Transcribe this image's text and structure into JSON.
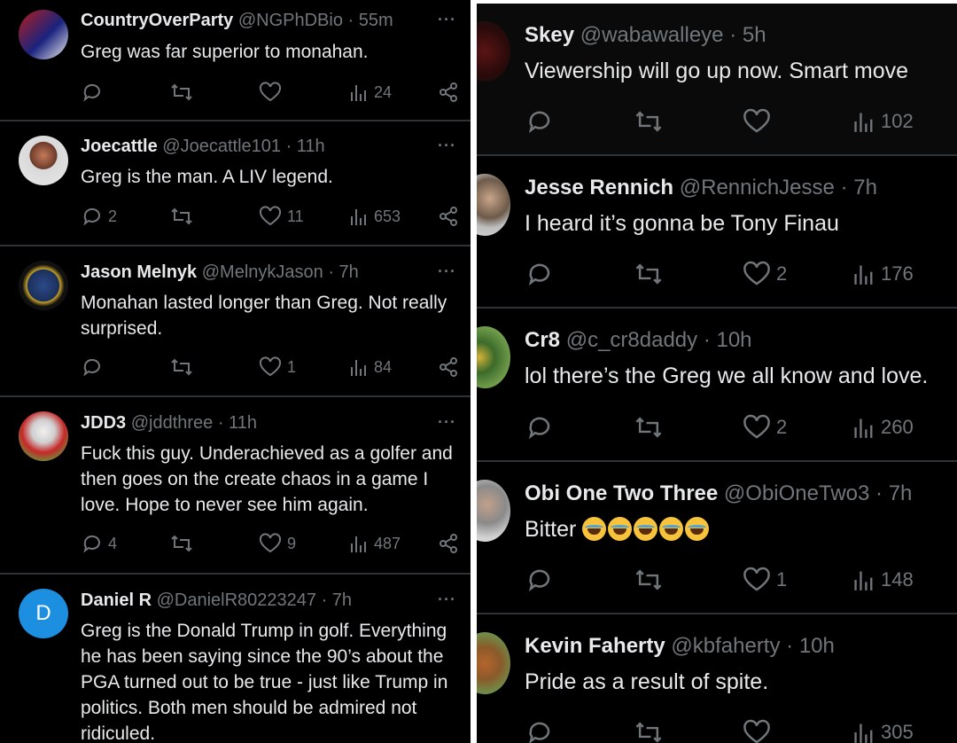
{
  "left_column": {
    "tweets": [
      {
        "name": "CountryOverParty",
        "handle": "@NGPhDBio",
        "time": "· 55m",
        "more": "···",
        "text": "Greg was far superior to monahan.",
        "replies": "",
        "retweets": "",
        "likes": "",
        "views": "24"
      },
      {
        "name": "Joecattle",
        "handle": "@Joecattle101",
        "time": "· 11h",
        "more": "···",
        "text": "Greg is the man.  A LIV legend.",
        "replies": "2",
        "retweets": "",
        "likes": "11",
        "views": "653"
      },
      {
        "name": "Jason Melnyk",
        "handle": "@MelnykJason",
        "time": "· 7h",
        "more": "···",
        "text": "Monahan lasted longer than Greg. Not really surprised.",
        "replies": "",
        "retweets": "",
        "likes": "1",
        "views": "84"
      },
      {
        "name": "JDD3",
        "handle": "@jddthree",
        "time": "· 11h",
        "more": "···",
        "text": "Fuck this guy.   Underachieved as a golfer and then goes on the create chaos in a game I love.   Hope to never see him again.",
        "replies": "4",
        "retweets": "",
        "likes": "9",
        "views": "487"
      },
      {
        "name": "Daniel R",
        "handle": "@DanielR80223247",
        "time": "· 7h",
        "more": "···",
        "avatar_letter": "D",
        "text": "Greg is the Donald Trump in golf. Everything he has been saying since the 90’s about the PGA turned out to be true - just like Trump in politics. Both men should be admired not ridiculed."
      }
    ]
  },
  "right_column": {
    "tweets": [
      {
        "name": "Skey",
        "handle": "@wabawalleye",
        "time": "· 5h",
        "text": "Viewership will go up now. Smart move",
        "replies": "",
        "retweets": "",
        "likes": "",
        "views": "102"
      },
      {
        "name": "Jesse Rennich",
        "handle": "@RennichJesse",
        "time": "· 7h",
        "text": "I heard it’s gonna be Tony Finau",
        "replies": "",
        "retweets": "",
        "likes": "2",
        "views": "176"
      },
      {
        "name": "Cr8",
        "handle": "@c_cr8daddy",
        "time": "· 10h",
        "text": "lol there’s the Greg we all know and love.",
        "replies": "",
        "retweets": "",
        "likes": "2",
        "views": "260"
      },
      {
        "name": "Obi One Two Three",
        "handle": "@ObiOneTwo3",
        "time": "· 7h",
        "text": "Bitter",
        "emoji_count": 5,
        "replies": "",
        "retweets": "",
        "likes": "1",
        "views": "148"
      },
      {
        "name": "Kevin Faherty",
        "handle": "@kbfaherty",
        "time": "· 10h",
        "text": "Pride as a result of spite.",
        "replies": "",
        "retweets": "",
        "likes": "",
        "views": "305"
      }
    ]
  },
  "icons": {
    "reply": "reply-icon",
    "retweet": "retweet-icon",
    "like": "heart-icon",
    "views": "views-icon",
    "share": "share-icon",
    "more": "more-icon"
  },
  "colors": {
    "background": "#000000",
    "text": "#e7e9ea",
    "muted": "#71767b",
    "divider": "#2f3336",
    "avatar_blue": "#1d8fe1"
  }
}
